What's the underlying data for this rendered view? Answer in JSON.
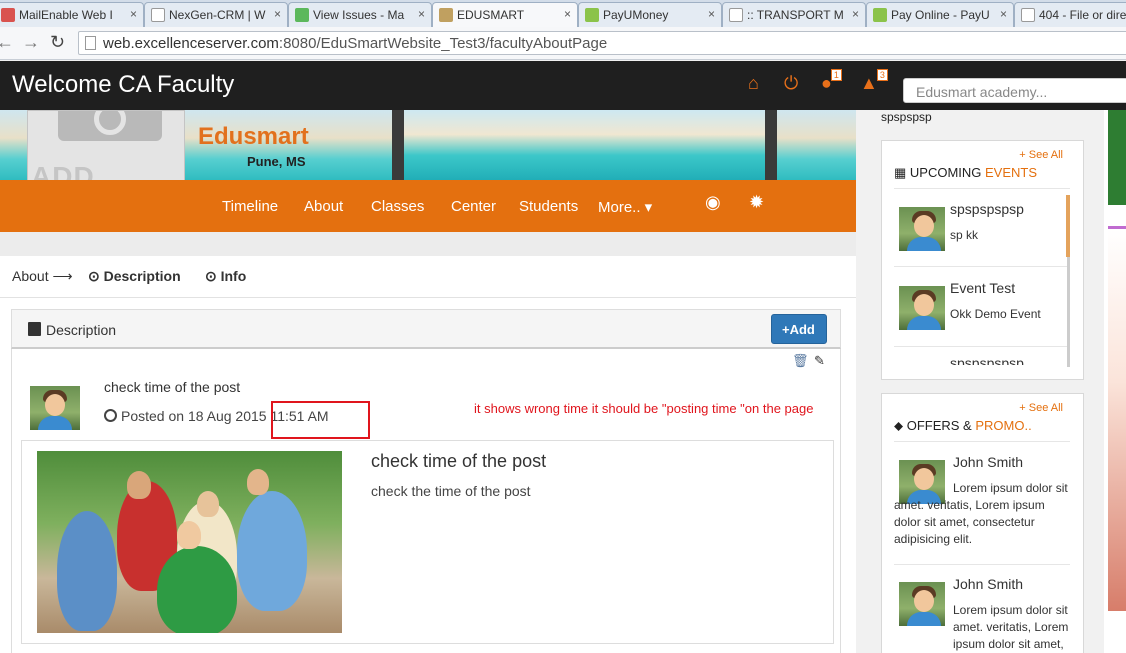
{
  "browser": {
    "tabs": [
      {
        "title": "MailEnable Web I",
        "icon_color": "#d9534f"
      },
      {
        "title": "NexGen-CRM | W",
        "icon_color": "#ffffff"
      },
      {
        "title": "View Issues - Ma",
        "icon_color": "#5cb85c"
      },
      {
        "title": "EDUSMART",
        "icon_color": "#c0a060",
        "active": true
      },
      {
        "title": "PayUMoney",
        "icon_color": "#8bc34a"
      },
      {
        "title": ":: TRANSPORT M",
        "icon_color": "#ffffff"
      },
      {
        "title": "Pay Online - PayU",
        "icon_color": "#8bc34a"
      },
      {
        "title": "404 - File or dire",
        "icon_color": "#ffffff"
      }
    ],
    "tab_close": "×",
    "url_host": "web.excellenceserver.com",
    "url_rest": ":8080/EduSmartWebsite_Test3/facultyAboutPage",
    "back": "←",
    "forward": "→",
    "reload": "↻"
  },
  "header": {
    "welcome": "Welcome CA Faculty",
    "home_icon": "⌂",
    "power_icon": "⏻",
    "chat_icon": "●",
    "chat_count": "1",
    "bell_icon": "▲",
    "bell_count": "3",
    "search_placeholder": "Edusmart academy..."
  },
  "profile": {
    "add_logo": "ADD LOGO",
    "school_name": "Edusmart",
    "city": "Pune, MS"
  },
  "orange_nav": {
    "items": [
      "Timeline",
      "About",
      "Classes",
      "Center",
      "Students",
      "More.. ▾"
    ],
    "eye_icon": "◉",
    "gear_icon": "✹"
  },
  "breadcrumb": {
    "about": "About ⟶",
    "description": "⊙ Description",
    "info": "⊙ Info"
  },
  "panel": {
    "title": "Description",
    "add_button": "+Add",
    "delete_icon": "🗑",
    "edit_icon": "✎"
  },
  "post": {
    "title": "check time of the post",
    "posted_on": "Posted on 18 Aug 2015",
    "time": "11:51 AM",
    "annotation": "it shows wrong time it should be \"posting time \"on the page",
    "card_title": "check time of the post",
    "card_body": "check the time of the post"
  },
  "sidebar": {
    "top_text": "spspspsp",
    "events": {
      "see_all": "+ See All",
      "title_prefix": "▦ UPCOMING ",
      "title_accent": "EVENTS",
      "items": [
        {
          "name": "spspspspsp",
          "desc": "sp kk"
        },
        {
          "name": "Event Test",
          "desc": "Okk Demo Event"
        },
        {
          "name": "spspspspsp",
          "desc": ""
        }
      ]
    },
    "offers": {
      "see_all": "+ See All",
      "title_prefix": "⬥ OFFERS & ",
      "title_accent": "PROMO..",
      "items": [
        {
          "name": "John Smith",
          "desc": "Lorem ipsum dolor sit amet. veritatis, Lorem ipsum dolor sit amet, consectetur adipisicing elit."
        },
        {
          "name": "John Smith",
          "desc": "Lorem ipsum dolor sit amet. veritatis, Lorem ipsum dolor sit amet,"
        }
      ]
    }
  },
  "colors": {
    "accent_orange": "#e4700f",
    "header_dark": "#1f1f1f",
    "annotation_red": "#e0151d",
    "button_blue": "#2f78b8"
  }
}
